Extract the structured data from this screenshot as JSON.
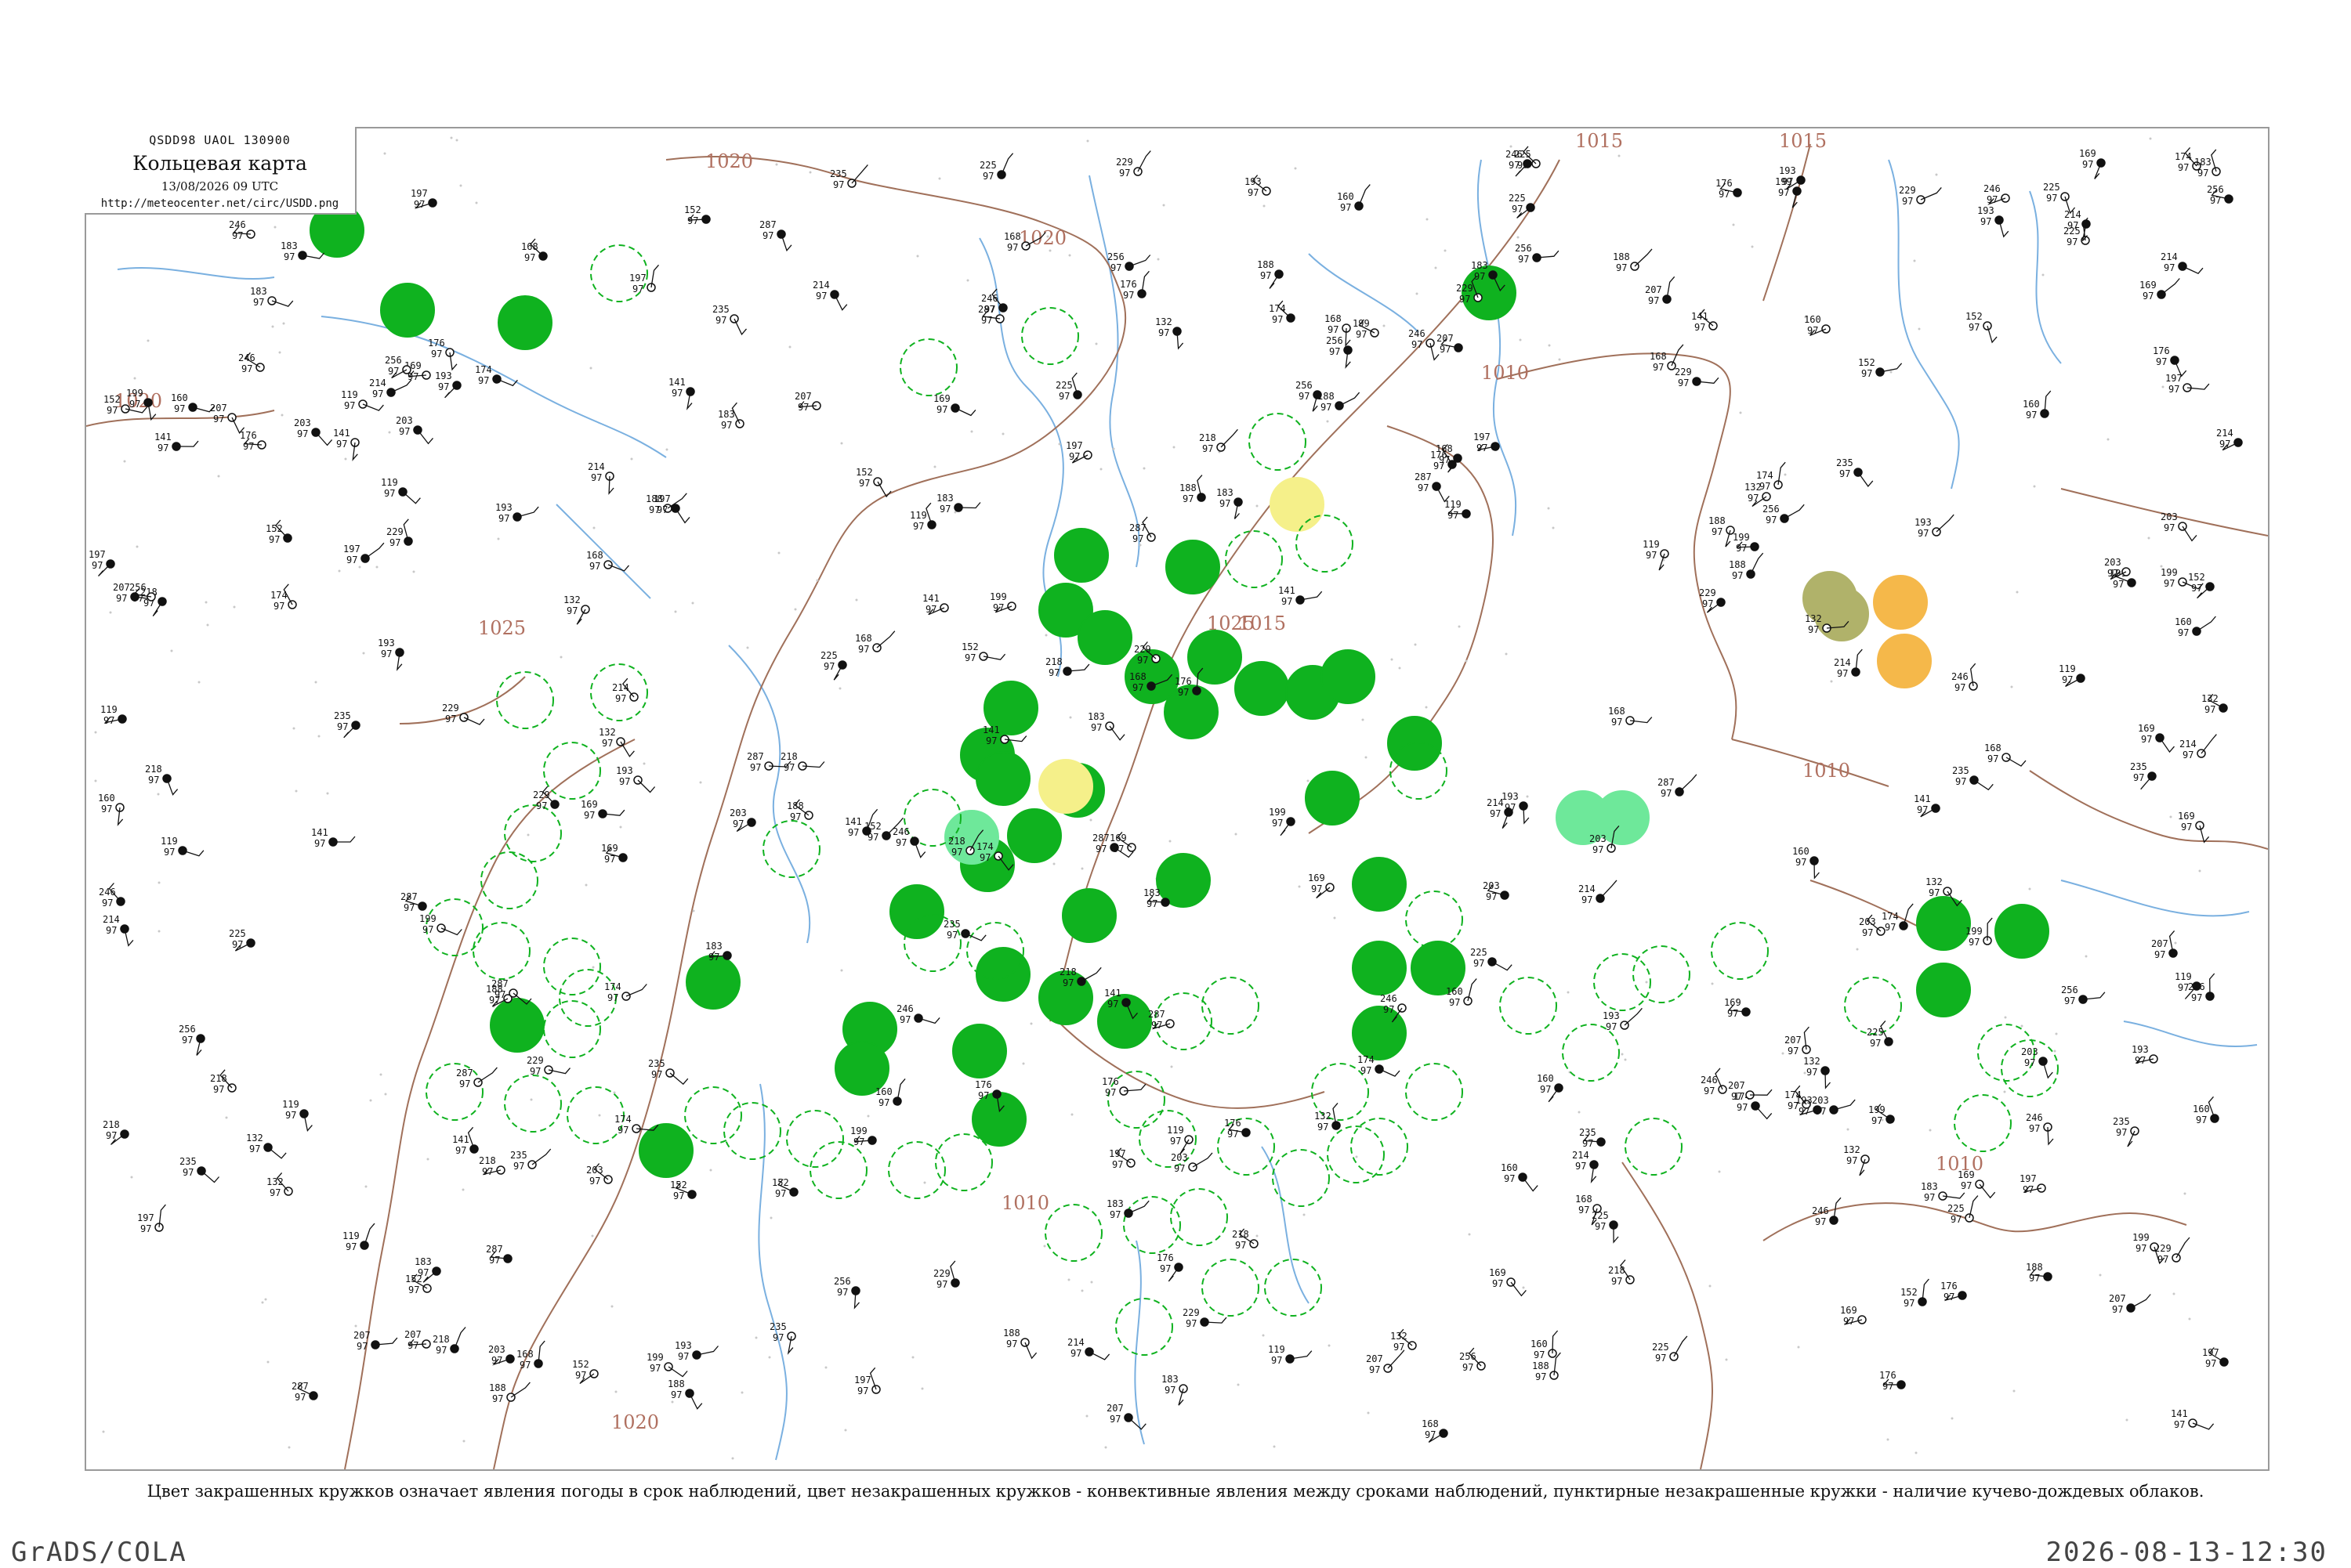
{
  "header": {
    "codes": "QSDD98  UAOL  130900",
    "title": "Кольцевая карта",
    "datetime": "13/08/2026 09 UTC",
    "url": "http://meteocenter.net/circ/USDD.png"
  },
  "caption": "Цвет закрашенных кружков означает явления погоды в срок наблюдений, цвет незакрашенных кружков - конвективные явления между сроками наблюдений, пунктирные незакрашенные кружки - наличие кучево-дождевых облаков.",
  "footer": {
    "left": "GrADS/COLA",
    "right": "2026-08-13-12:30"
  },
  "isobar_labels": [
    "1020",
    "1020",
    "1020",
    "1015",
    "1015",
    "1015",
    "1010",
    "1010",
    "1010",
    "1010",
    "1025",
    "1025",
    "1020"
  ],
  "colors": {
    "rain_fill": "#0fb21f",
    "yellow_fill": "#f5f08a",
    "orange_fill": "#f5b84a",
    "olive_fill": "#b0b26a",
    "mint_fill": "#6ee89a",
    "isobar": "#a0705a",
    "river": "#7ab0e0",
    "border": "#9a9a9a"
  },
  "sample_stations": [
    {
      "num": "199",
      "lbl": "97"
    },
    {
      "num": "235",
      "lbl": "97"
    },
    {
      "num": "183",
      "lbl": "97"
    },
    {
      "num": "152",
      "lbl": "97"
    },
    {
      "num": "169",
      "lbl": "97"
    },
    {
      "num": "214",
      "lbl": "97"
    },
    {
      "num": "246",
      "lbl": "97"
    },
    {
      "num": "188",
      "lbl": "97"
    },
    {
      "num": "176",
      "lbl": "97"
    },
    {
      "num": "207",
      "lbl": "97"
    },
    {
      "num": "193",
      "lbl": "97"
    },
    {
      "num": "160",
      "lbl": "97"
    },
    {
      "num": "218",
      "lbl": "97"
    },
    {
      "num": "132",
      "lbl": "97"
    },
    {
      "num": "229",
      "lbl": "97"
    },
    {
      "num": "174",
      "lbl": "97"
    },
    {
      "num": "141",
      "lbl": "97"
    },
    {
      "num": "256",
      "lbl": "97"
    },
    {
      "num": "203",
      "lbl": "97"
    },
    {
      "num": "119",
      "lbl": "97"
    },
    {
      "num": "287",
      "lbl": "97"
    },
    {
      "num": "168",
      "lbl": "97"
    },
    {
      "num": "225",
      "lbl": "97"
    },
    {
      "num": "197",
      "lbl": "97"
    }
  ]
}
